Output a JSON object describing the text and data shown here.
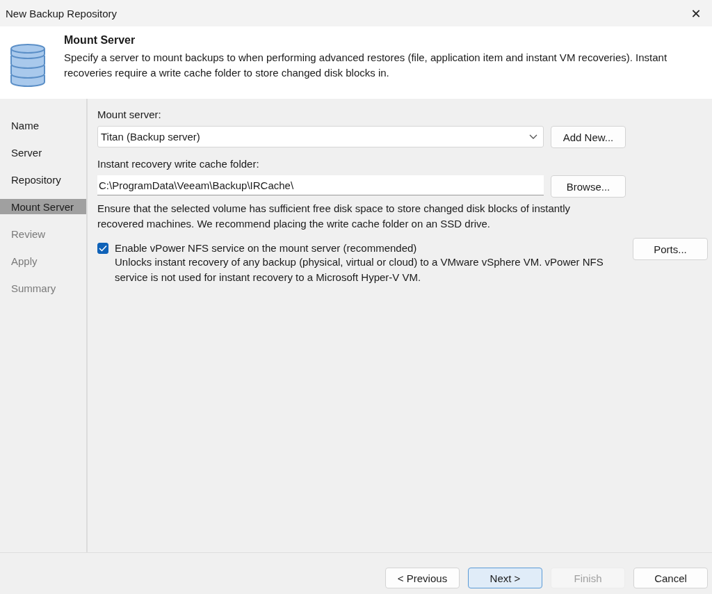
{
  "window": {
    "title": "New Backup Repository",
    "close": "✕"
  },
  "header": {
    "title": "Mount Server",
    "description": "Specify a server to mount backups to when performing advanced restores (file, application item and instant VM recoveries). Instant recoveries require a write cache folder to store changed disk blocks in."
  },
  "sidebar": {
    "items": [
      {
        "label": "Name",
        "selected": false,
        "disabled": false
      },
      {
        "label": "Server",
        "selected": false,
        "disabled": false
      },
      {
        "label": "Repository",
        "selected": false,
        "disabled": false
      },
      {
        "label": "Mount Server",
        "selected": true,
        "disabled": false
      },
      {
        "label": "Review",
        "selected": false,
        "disabled": true
      },
      {
        "label": "Apply",
        "selected": false,
        "disabled": true
      },
      {
        "label": "Summary",
        "selected": false,
        "disabled": true
      }
    ]
  },
  "mount_server": {
    "label": "Mount server:",
    "value": "Titan (Backup server)",
    "button": "Add New..."
  },
  "cache_folder": {
    "label": "Instant recovery write cache folder:",
    "value": "C:\\ProgramData\\Veeam\\Backup\\IRCache\\",
    "button": "Browse...",
    "note": "Ensure that the selected volume has sufficient free disk space to store changed disk blocks of instantly recovered machines. We recommend placing the write cache folder on an SSD drive."
  },
  "vpower": {
    "label": "Enable vPower NFS service on the mount server (recommended)",
    "checked": true,
    "button": "Ports...",
    "note": "Unlocks instant recovery of any backup (physical, virtual or cloud) to a VMware vSphere VM.  vPower NFS service is not used for instant recovery to a Microsoft Hyper-V VM."
  },
  "buttons": [
    {
      "label": "< Previous",
      "default": false,
      "disabled": false
    },
    {
      "label": "Next >",
      "default": true,
      "disabled": false
    },
    {
      "label": "Finish",
      "default": false,
      "disabled": true
    },
    {
      "label": "Cancel",
      "default": false,
      "disabled": false
    }
  ]
}
